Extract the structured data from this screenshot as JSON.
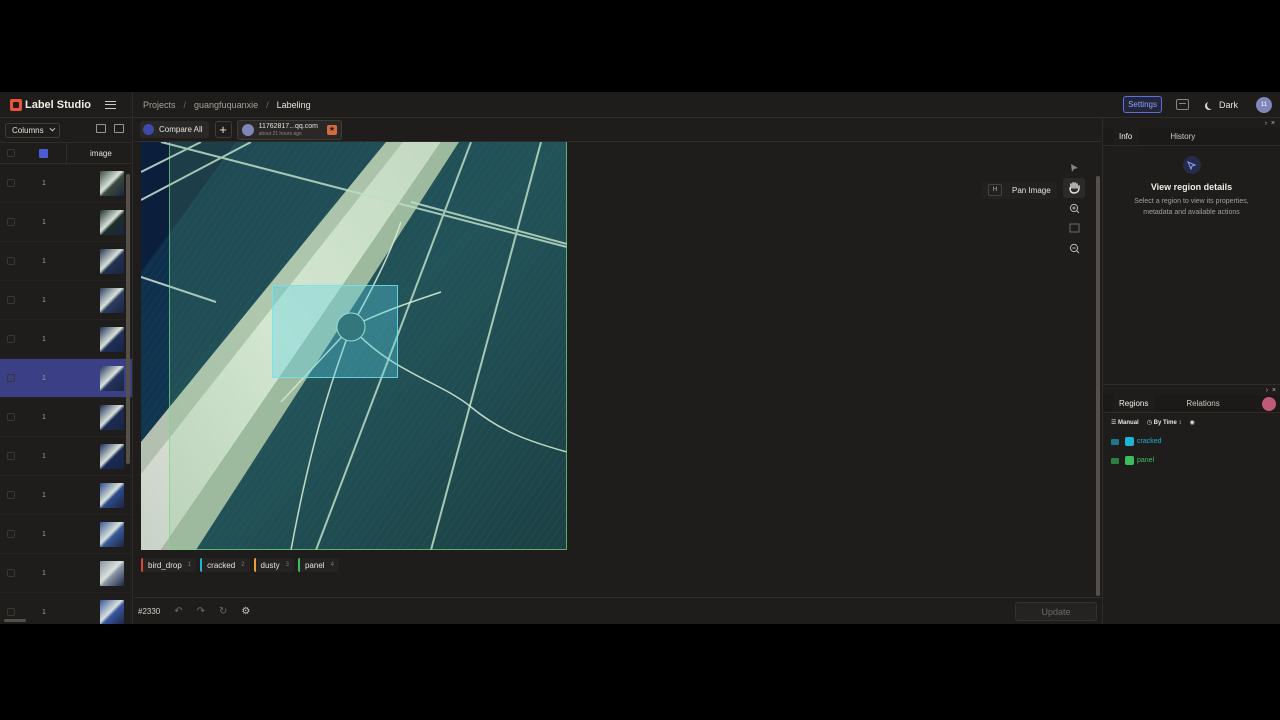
{
  "app": {
    "name": "Label Studio"
  },
  "breadcrumb": [
    "Projects",
    "guangfuquanxie",
    "Labeling"
  ],
  "header": {
    "settings_label": "Settings",
    "theme_label": "Dark",
    "user_initials": "11"
  },
  "list": {
    "columns_label": "Columns",
    "image_column": "image",
    "rows": [
      {
        "num": "1"
      },
      {
        "num": "1"
      },
      {
        "num": "1"
      },
      {
        "num": "1"
      },
      {
        "num": "1"
      },
      {
        "num": "1"
      },
      {
        "num": "1"
      },
      {
        "num": "1"
      },
      {
        "num": "1"
      },
      {
        "num": "1"
      },
      {
        "num": "1"
      },
      {
        "num": "1"
      }
    ]
  },
  "annotation_tabs": {
    "compare_label": "Compare All",
    "annotator": "11762817...qq.com",
    "time": "about 21 hours ago"
  },
  "tools": {
    "pan_key": "H",
    "pan_label": "Pan Image"
  },
  "labels": [
    {
      "name": "bird_drop",
      "key": "1",
      "color": "#d9463a"
    },
    {
      "name": "cracked",
      "key": "2",
      "color": "#1fb4d6"
    },
    {
      "name": "dusty",
      "key": "3",
      "color": "#e8a13a"
    },
    {
      "name": "panel",
      "key": "4",
      "color": "#3bbf5c"
    }
  ],
  "bottom": {
    "task_id": "#2330",
    "update_label": "Update"
  },
  "info_panel": {
    "tabs": [
      "Info",
      "History"
    ],
    "title": "View region details",
    "desc": "Select a region to view its properties, metadata and available actions"
  },
  "regions_panel": {
    "tabs": [
      "Regions",
      "Relations"
    ],
    "filter_manual": "Manual",
    "filter_time": "By Time",
    "items": [
      {
        "label": "cracked",
        "color": "#1fb4d6"
      },
      {
        "label": "panel",
        "color": "#3bbf5c"
      }
    ]
  }
}
